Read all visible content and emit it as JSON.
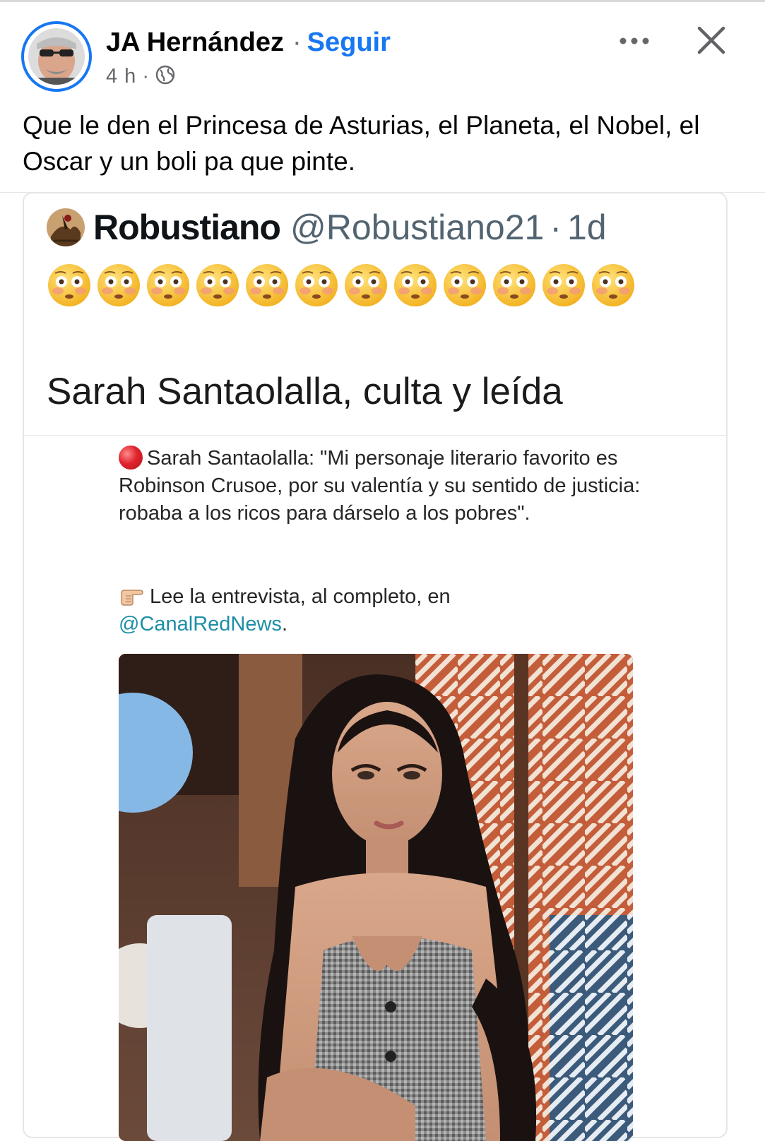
{
  "post": {
    "author": "JA Hernández",
    "separator": "·",
    "follow_label": "Seguir",
    "time": "4 h",
    "meta_separator": "·",
    "audience_icon": "globe-icon",
    "text": "Que le den el Princesa de Asturias, el Planeta, el Nobel, el Oscar y un boli pa que pinte.",
    "more_icon": "more-horizontal-icon",
    "close_icon": "close-icon"
  },
  "tweet": {
    "name": "Robustiano",
    "handle": "@Robustiano21",
    "separator": "·",
    "time": "1d",
    "emoji_icon": "flushed-face-icon",
    "emoji_count": 12,
    "headline": "Sarah Santaolalla, culta y leída",
    "quote": "Sarah Santaolalla: \"Mi personaje literario favorito es Robinson Crusoe, por su valentía y su sentido de justicia: robaba a los ricos para dárselo a los pobres\".",
    "read_prefix": "Lee la entrevista, al completo, en",
    "mention": "@CanalRedNews",
    "read_suffix": "."
  },
  "colors": {
    "accent": "#1877f2",
    "mention": "#1d8ea6",
    "muted": "#65676b"
  }
}
